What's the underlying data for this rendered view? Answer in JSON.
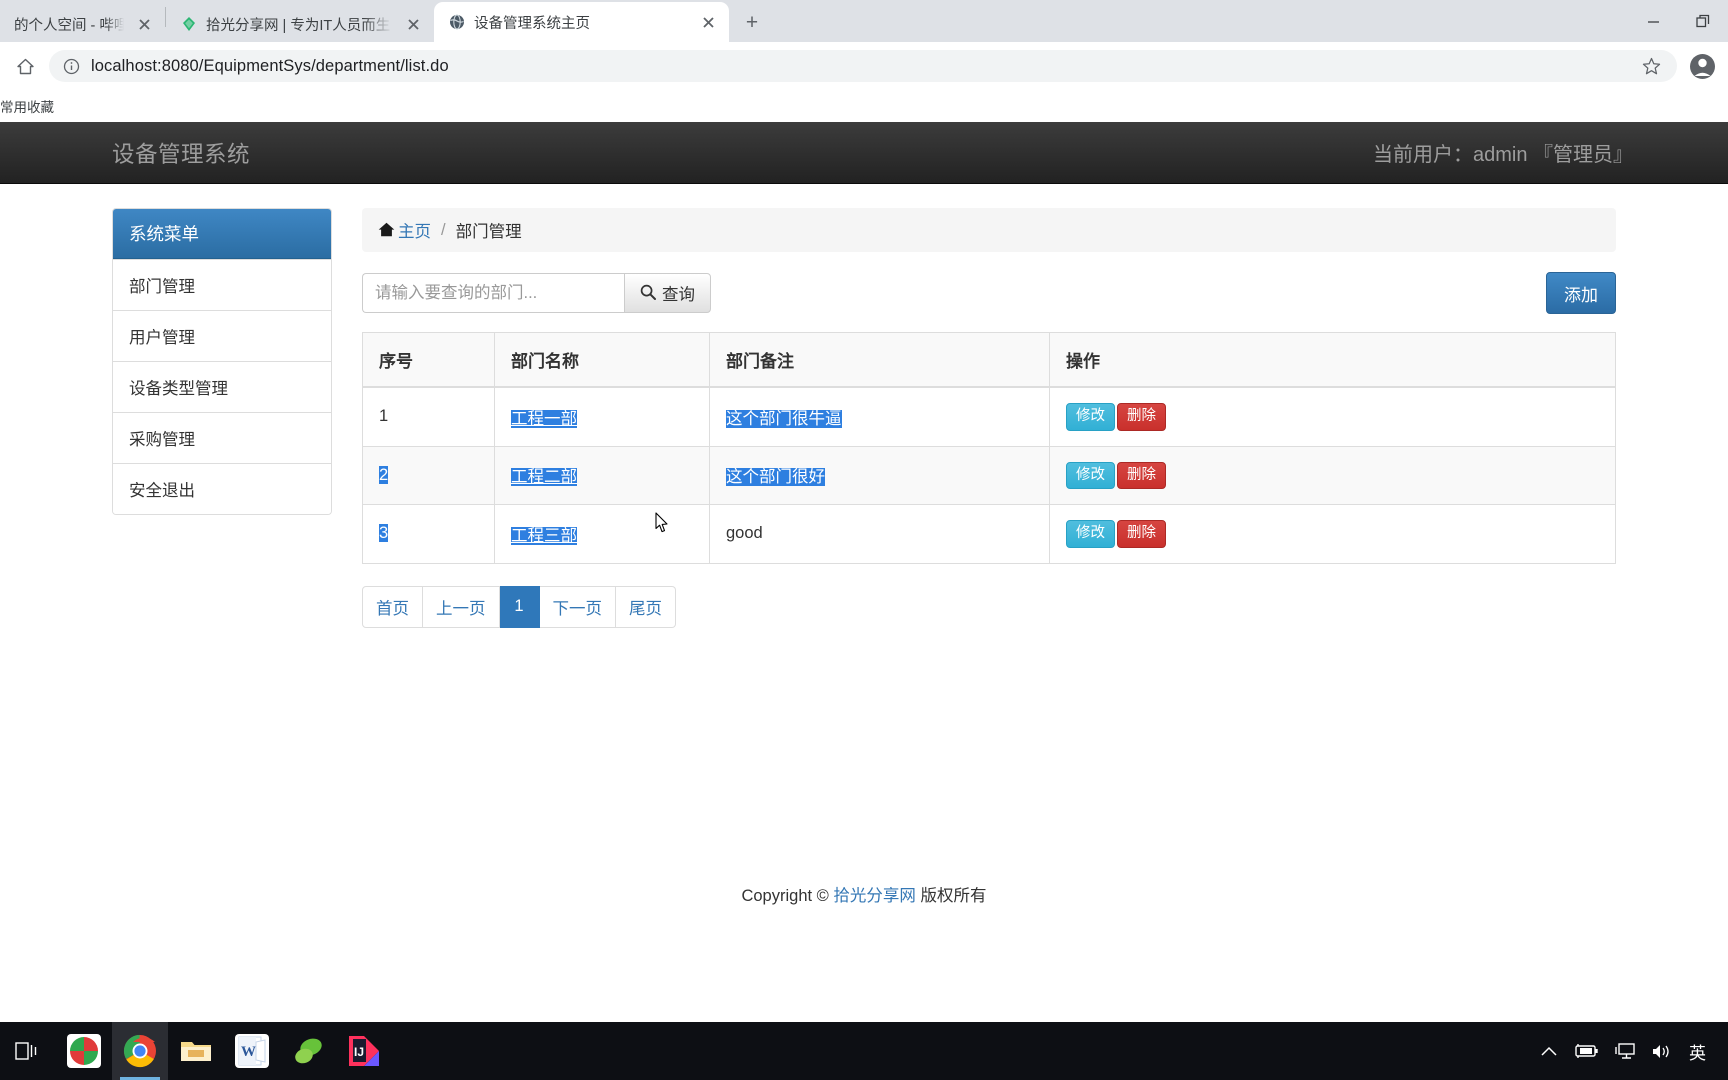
{
  "browser": {
    "tabs": [
      {
        "title": "的个人空间 - 哔哩哔",
        "favicon": "none",
        "active": false
      },
      {
        "title": "拾光分享网 | 专为IT人员而生",
        "favicon": "leaf-green-icon",
        "active": false
      },
      {
        "title": "设备管理系统主页",
        "favicon": "globe-icon",
        "active": true
      }
    ],
    "newtab_label": "+",
    "url_scheme": "localhost:8080",
    "url_path": "/EquipmentSys/department/list.do",
    "url_full": "localhost:8080/EquipmentSys/department/list.do",
    "bookmarks": [
      {
        "label": "常用收藏"
      }
    ],
    "window_controls": {
      "minimize": "minimize-icon",
      "maximize": "restore-icon"
    }
  },
  "app": {
    "brand": "设备管理系统",
    "user_info": "当前用户：admin 『管理员』",
    "accent_color": "#2b6da3",
    "header_bg": "#222222"
  },
  "sidebar": {
    "title": "系统菜单",
    "items": [
      {
        "label": "部门管理"
      },
      {
        "label": "用户管理"
      },
      {
        "label": "设备类型管理"
      },
      {
        "label": "采购管理"
      },
      {
        "label": "安全退出"
      }
    ]
  },
  "breadcrumb": {
    "home": "主页",
    "separator": "/",
    "current": "部门管理"
  },
  "search": {
    "placeholder": "请输入要查询的部门...",
    "value": "",
    "button_label": "查询"
  },
  "actions": {
    "add_label": "添加"
  },
  "table": {
    "columns": [
      "序号",
      "部门名称",
      "部门备注",
      "操作"
    ],
    "rows": [
      {
        "index": "1",
        "name": "工程一部",
        "note": "这个部门很牛逼",
        "edit": "修改",
        "delete": "删除",
        "selected": {
          "index": false,
          "name": true,
          "note": true
        }
      },
      {
        "index": "2",
        "name": "工程二部",
        "note": "这个部门很好",
        "edit": "修改",
        "delete": "删除",
        "selected": {
          "index": true,
          "name": true,
          "note": true
        }
      },
      {
        "index": "3",
        "name": "工程三部",
        "note": "good",
        "edit": "修改",
        "delete": "删除",
        "selected": {
          "index": true,
          "name": true,
          "note": false
        }
      }
    ]
  },
  "pagination": {
    "first": "首页",
    "prev": "上一页",
    "current": "1",
    "next": "下一页",
    "last": "尾页"
  },
  "footer": {
    "prefix": "Copyright © ",
    "link": "拾光分享网",
    "suffix": " 版权所有"
  },
  "taskbar": {
    "buttons": [
      {
        "name": "task-view-icon"
      },
      {
        "name": "xmind-icon"
      },
      {
        "name": "chrome-icon"
      },
      {
        "name": "file-explorer-icon"
      },
      {
        "name": "word-icon"
      },
      {
        "name": "navicat-icon"
      },
      {
        "name": "intellij-idea-icon"
      }
    ],
    "tray": [
      {
        "name": "chevron-up-icon"
      },
      {
        "name": "battery-charging-icon"
      },
      {
        "name": "network-icon"
      },
      {
        "name": "volume-icon"
      },
      {
        "name": "ime-indicator",
        "label": "英"
      }
    ]
  }
}
